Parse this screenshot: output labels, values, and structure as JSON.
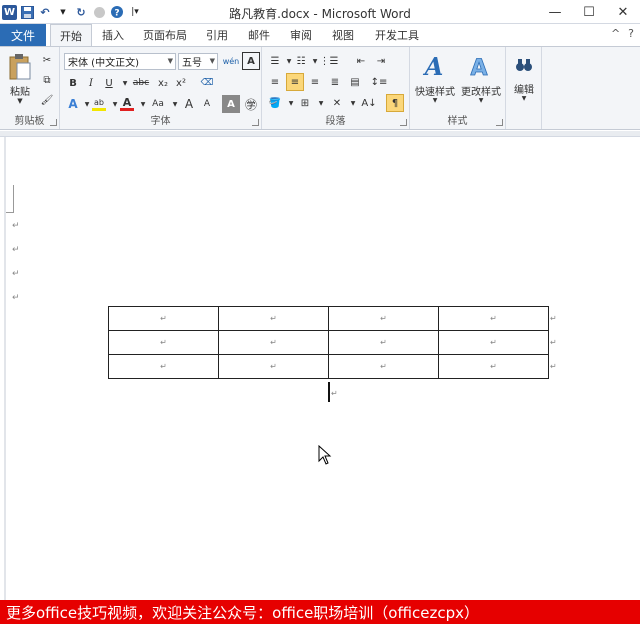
{
  "title_bar": {
    "title": "路凡教育.docx - Microsoft Word",
    "min": "—",
    "max": "☐",
    "close": "✕"
  },
  "qat": {
    "logo": "W",
    "save": "💾",
    "undo": "↶",
    "redo": "↻",
    "disabled": "◌",
    "help": "?"
  },
  "tabs": {
    "file": "文件",
    "items": [
      "开始",
      "插入",
      "页面布局",
      "引用",
      "邮件",
      "审阅",
      "视图",
      "开发工具"
    ],
    "active_index": 0,
    "right_up": "^",
    "right_help": "?"
  },
  "ribbon": {
    "clipboard": {
      "label": "剪贴板",
      "paste": "粘贴"
    },
    "font": {
      "label": "字体",
      "font_name": "宋体 (中文正文)",
      "font_size": "五号",
      "bold": "B",
      "italic": "I",
      "underline": "U",
      "strike": "abc",
      "subscript": "x₂",
      "superscript": "x²",
      "change_case": "Aa",
      "grow": "A",
      "shrink": "A",
      "phonetic": "wén",
      "border_char": "A"
    },
    "paragraph": {
      "label": "段落"
    },
    "styles": {
      "label": "样式",
      "quick": "快速样式",
      "change": "更改样式"
    },
    "editing": {
      "label": "编辑"
    }
  },
  "document": {
    "para_mark": "↵",
    "table": {
      "rows": 3,
      "cols": 4
    }
  },
  "banner": {
    "text": "更多office技巧视频，欢迎关注公众号：office职场培训（officezcpx）"
  },
  "colors": {
    "file_tab": "#2b6cb5",
    "banner": "#e60000",
    "ribbon_bg": "#f3f5f8"
  }
}
